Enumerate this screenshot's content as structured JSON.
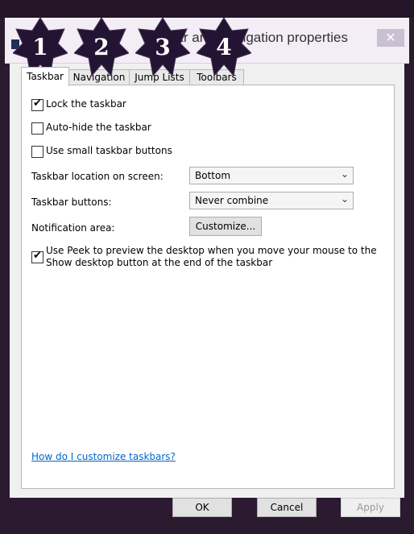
{
  "window": {
    "title": "Taskbar and Navigation properties",
    "close_glyph": "✕"
  },
  "stars": [
    "1",
    "2",
    "3",
    "4"
  ],
  "tabs": [
    "Taskbar",
    "Navigation",
    "Jump Lists",
    "Toolbars"
  ],
  "options": {
    "lock_taskbar": {
      "label": "Lock the taskbar",
      "checked": true
    },
    "auto_hide": {
      "label": "Auto-hide the taskbar",
      "checked": false
    },
    "small_buttons": {
      "label": "Use small taskbar buttons",
      "checked": false
    },
    "location_label": "Taskbar location on screen:",
    "location_value": "Bottom",
    "buttons_label": "Taskbar buttons:",
    "buttons_value": "Never combine",
    "notification_label": "Notification area:",
    "customize_button": "Customize...",
    "peek_line1": "Use Peek to preview the desktop when you move your mouse to the",
    "peek_line2": "Show desktop button at the end of the taskbar",
    "peek_checked": true
  },
  "help_link": "How do I customize taskbars?",
  "footer": {
    "ok": "OK",
    "cancel": "Cancel",
    "apply": "Apply"
  }
}
